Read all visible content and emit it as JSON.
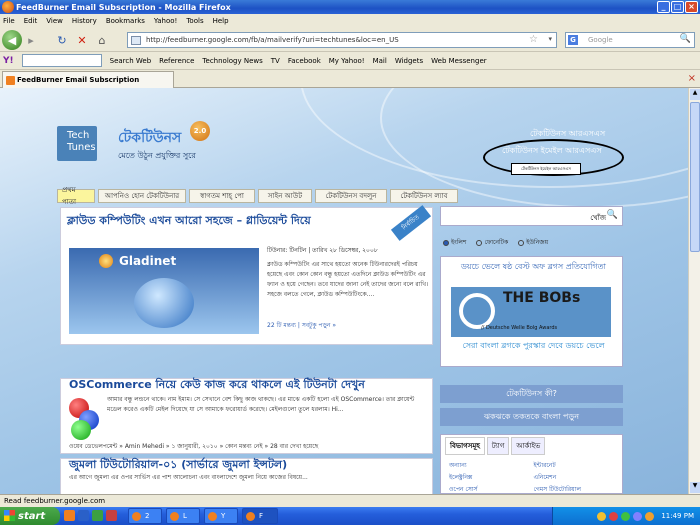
{
  "window": {
    "title": "FeedBurner Email Subscription - Mozilla Firefox",
    "btn_min": "_",
    "btn_max": "□",
    "btn_close": "×"
  },
  "menu": [
    "File",
    "Edit",
    "View",
    "History",
    "Bookmarks",
    "Yahoo!",
    "Tools",
    "Help"
  ],
  "nav": {
    "url": "http://feedburner.google.com/fb/a/mailverify?uri=techtunes&loc=en_US",
    "search_placeholder": "Google",
    "back": "◀",
    "forward": "▸",
    "reload": "↻",
    "stop": "✕",
    "home": "⌂",
    "star": "☆",
    "drop": "▾",
    "search_mag": "🔍",
    "search_engine": "G"
  },
  "yahoo_toolbar": {
    "logo": "Y!",
    "items": [
      "Search Web",
      "Reference",
      "Technology News",
      "TV",
      "Facebook",
      "My Yahoo!",
      "Mail",
      "Widgets",
      "Web Messenger"
    ]
  },
  "tab": {
    "label": "FeedBurner Email Subscription",
    "close": "×"
  },
  "scroll": {
    "up": "▲",
    "down": "▼"
  },
  "site": {
    "logo_text": "Tech Tunes",
    "logo_bn": "টেকটিউনস",
    "version": "2.0",
    "tagline": "মেতে উঠুন প্রযুক্তির সুরে",
    "header_link1": "টেকটিউনস আরএসএস",
    "header_link2": "টেকটিউনস ইমেইল আরএসএস",
    "tooltip": "টেকটিউনস ইমেইল আরএসএস",
    "nav_tabs": [
      "প্রথম পাতা",
      "আপনিও হোন টেকটিউনার",
      "স্বাগতম শাহ্‌ পো",
      "সাইন আউট",
      "টেকটিউনস বদলুন",
      "টেকটিউনস ল্যাব"
    ]
  },
  "post1": {
    "title": "ক্লাউড কম্পিউটিং এখন আরো সহজে – গ্লাডিয়েন্ট দিয়ে",
    "ribbon": "নির্বাচিত",
    "image_label": "Gladinet",
    "meta": "টিউনার: টিনটিন | তারিখ ২৮ ডিসেম্বর, ২০০৮",
    "body": "ক্লাউড কম্পিউটিং এর সাথে হয়তো অনেক টিউনারদেরই পরিচয় হয়েছে এবং কোন কোন বন্ধু হয়তো এতদিনে ক্লাউড কম্পিউটিং এর ফ্যান ও হয়ে গেছেন। তবে যাদের জানা নেই তাদের জন্যে বলে রাখি। সহজে বলতে গেলে, ক্লাউড কম্পিউটিংকে....",
    "footer": "22 টি মন্তব্য | সবটুকু পড়ুন »"
  },
  "post2": {
    "title": "OSCommerce নিয়ে কেউ কাজ করে থাকলে এই টিউনটা দেখুন",
    "body": "আমার বন্ধু লন্ডনে থাকে। নাম ইমাম। সে সেখানে বেশ কিছু কাজ থাকছে। এর মাঝে একটি হলো এই OSCommerce। তার ক্লায়েন্ট মডেল করেও একটি মেইল দিয়েছে যা সে আমাকে ফরোয়ার্ড করেছে। মেইলগুলো তুলে ধরলাম। Hi...",
    "footer": "ওয়েব ডেভেলপমেন্ট » Amin Mehedi » ১ জানুয়ারী, ২০১০ » কোন মন্তব্য নেই » 28 বার দেখা হয়েছে"
  },
  "post3": {
    "title": "জুমলা টিউটোরিয়াল-০১ (সার্ভারে জুমলা ইন্সটল)",
    "body": "এর আগে জুমলা এর ওপর সার্ভিস এর পাশ আলোচনা এবং বাংলাদেশে জুমলা নিয়ে কাজের বিষয়ে..."
  },
  "sidebar": {
    "search_label": "খোঁজ",
    "search_icon": "🔍",
    "radios": [
      "ইংলিশ",
      "ফোনেটিক",
      "ইউনিজয়"
    ],
    "bobs_top": "ডয়চে ভেলে ষষ্ঠ বেস্ট অফ ব্লগস প্রতিযোগিতা",
    "bobs_name": "THE BOBs",
    "bobs_sub": "// Deutsche Welle Bolg Awards",
    "bobs_bottom": "সেরা বাংলা ব্লগকে পুরস্কার দেবে ডয়চে ভেলে",
    "bar1": "টেকটিউনস কী?",
    "bar2": "ঝকঝকে তকতকে বাংলা পড়ুন",
    "cat_tabs": [
      "বিভাগসমূহ",
      "ট্যাগ",
      "আর্কাইভ"
    ],
    "cats": [
      "অন্যান্য",
      "ইন্টারনেট",
      "ইলেক্ট্রনিক্স",
      "এনিমেশন",
      "ওপেন সোর্স",
      "গেমস টিউটোরিয়াল"
    ]
  },
  "status": "Read feedburner.google.com",
  "taskbar": {
    "start": "start",
    "tasks": [
      "2",
      "L",
      "Y",
      "F"
    ],
    "clock": "11:49 PM"
  }
}
